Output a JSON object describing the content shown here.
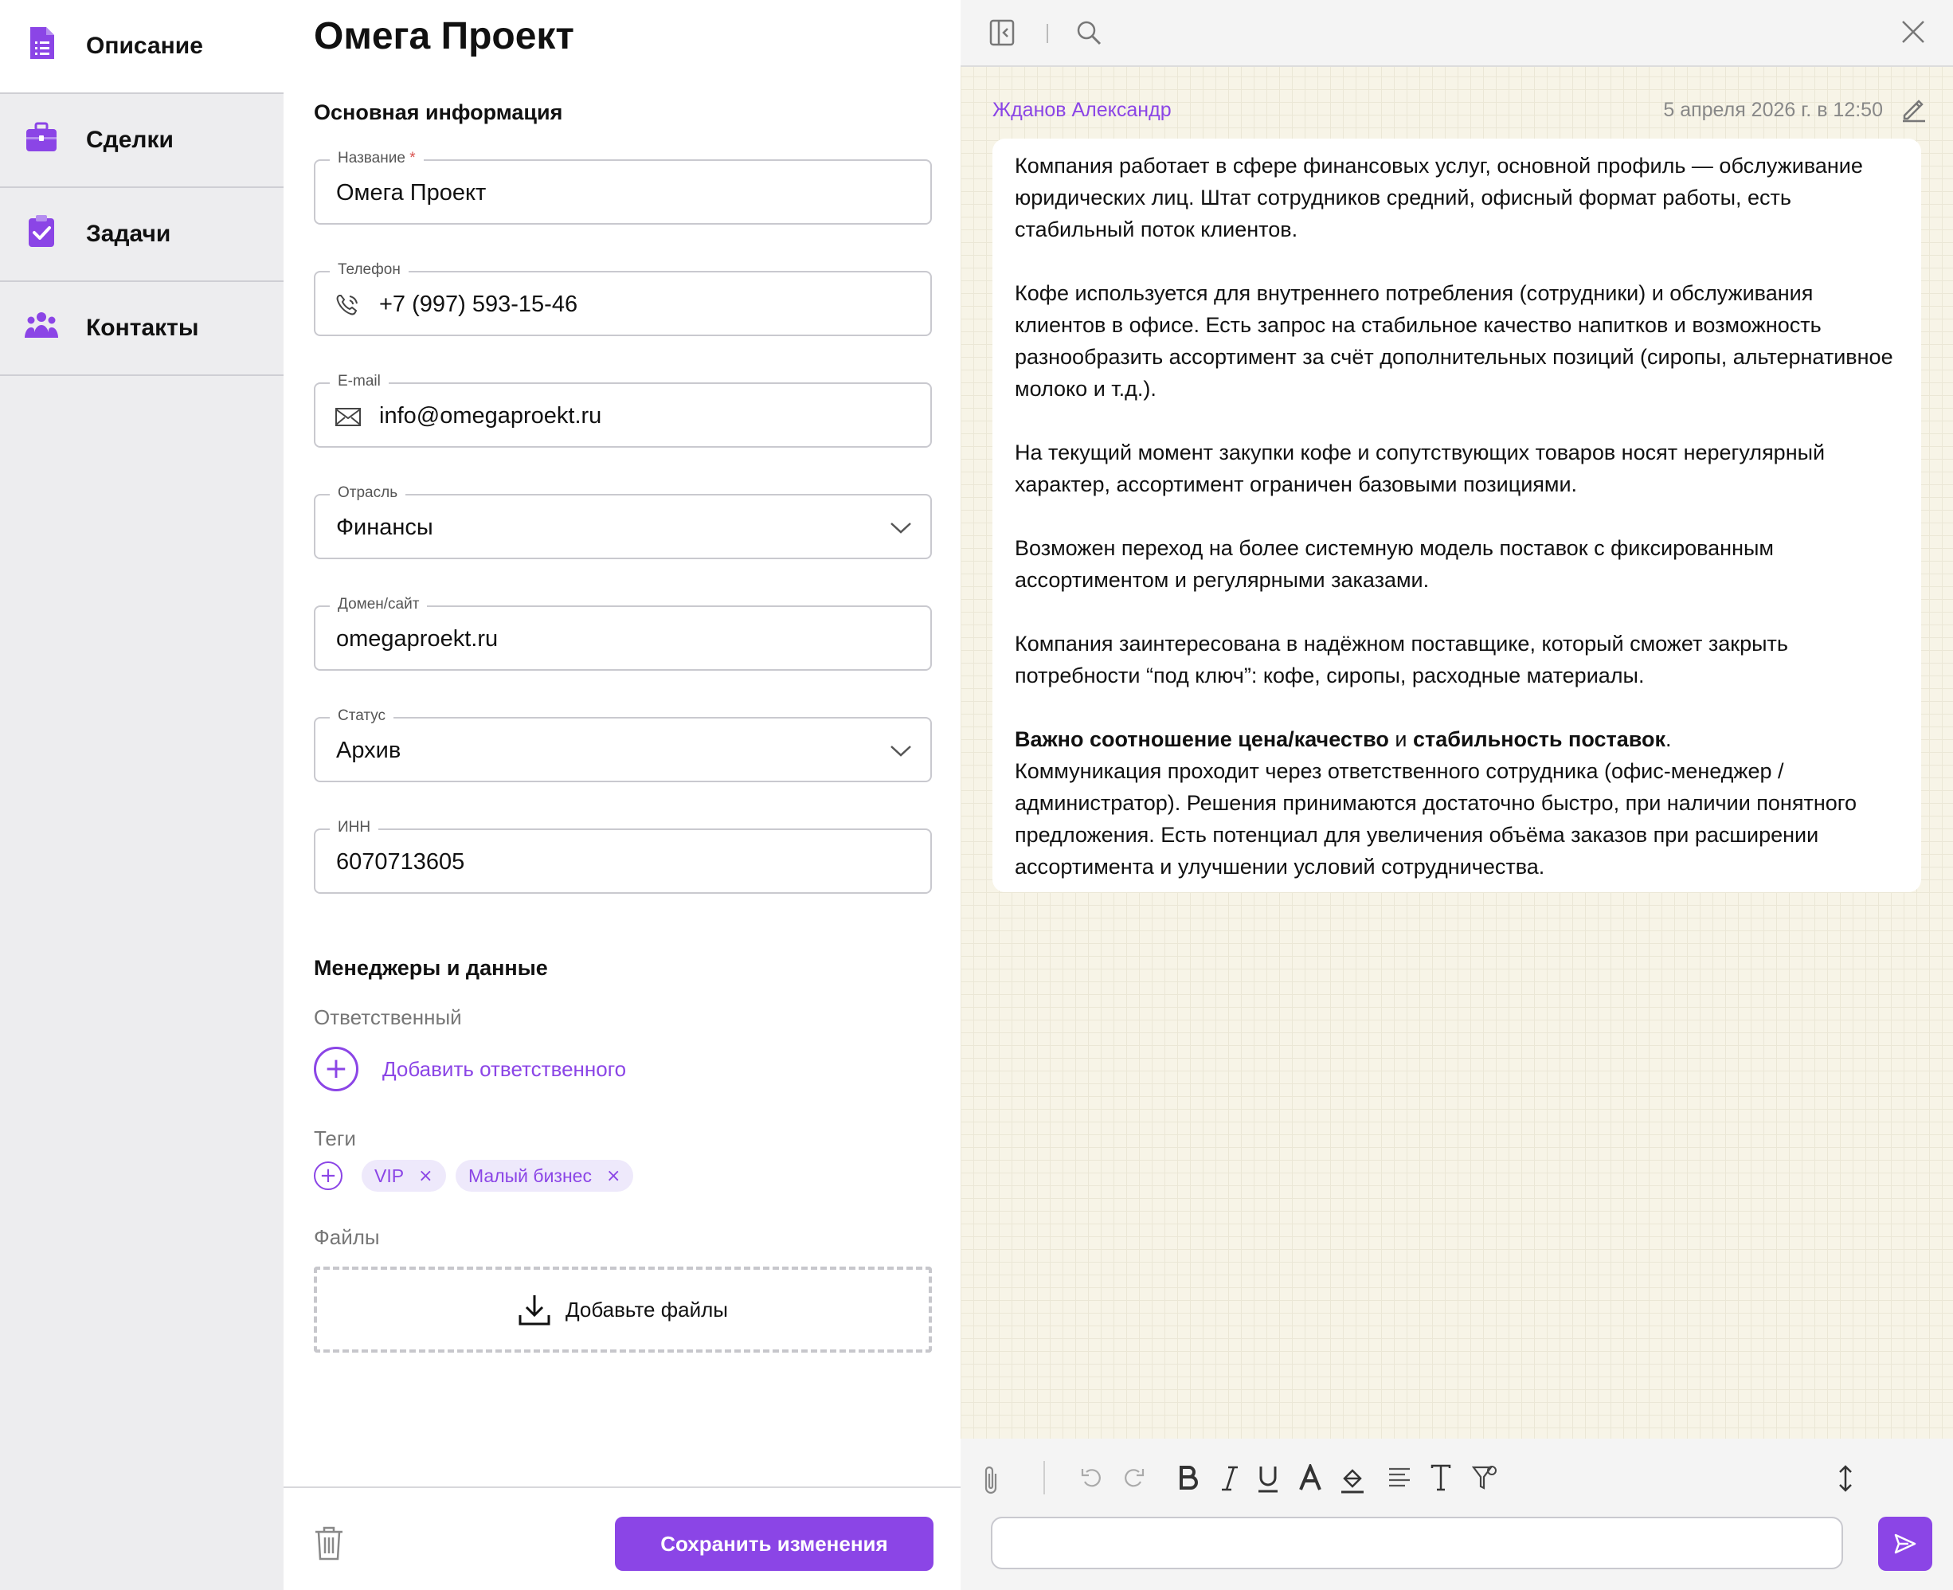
{
  "sidebar": {
    "items": [
      {
        "label": "Описание",
        "icon": "document-list-icon",
        "active": true
      },
      {
        "label": "Сделки",
        "icon": "briefcase-icon",
        "active": false
      },
      {
        "label": "Задачи",
        "icon": "clipboard-check-icon",
        "active": false
      },
      {
        "label": "Контакты",
        "icon": "people-icon",
        "active": false
      }
    ]
  },
  "main": {
    "title": "Омега Проект",
    "basic_section": "Основная информация",
    "fields": {
      "name": {
        "label": "Название",
        "required_mark": "*",
        "value": "Омега Проект"
      },
      "phone": {
        "label": "Телефон",
        "value": "+7 (997) 593-15-46"
      },
      "email": {
        "label": "E-mail",
        "value": "info@omegaproekt.ru"
      },
      "industry": {
        "label": "Отрасль",
        "value": "Финансы"
      },
      "domain": {
        "label": "Домен/сайт",
        "value": "omegaproekt.ru"
      },
      "status": {
        "label": "Статус",
        "value": "Архив"
      },
      "inn": {
        "label": "ИНН",
        "value": "6070713605"
      }
    },
    "managers_section": "Менеджеры и данные",
    "responsible_label": "Ответственный",
    "add_responsible": "Добавить ответственного",
    "tags_label": "Теги",
    "tags": [
      "VIP",
      "Малый бизнес"
    ],
    "files_label": "Файлы",
    "add_files": "Добавьте файлы",
    "save_button": "Сохранить изменения"
  },
  "note": {
    "author": "Жданов Александр",
    "timestamp": "5 апреля 2026 г. в 12:50",
    "paragraphs": [
      "Компания работает в сфере финансовых услуг, основной профиль — обслуживание юридических лиц. Штат сотрудников средний, офисный формат работы, есть стабильный поток клиентов.",
      "Кофе используется для внутреннего потребления (сотрудники) и обслуживания клиентов в офисе. Есть запрос на стабильное качество напитков и возможность разнообразить ассортимент за счёт дополнительных позиций (сиропы, альтернативное молоко и т.д.).",
      "На текущий момент закупки кофе и сопутствующих товаров носят нерегулярный характер, ассортимент ограничен базовыми позициями.",
      "Возможен переход на более системную модель поставок с фиксированным ассортиментом и регулярными заказами.",
      "Компания заинтересована в надёжном поставщике, который сможет закрыть потребности “под ключ”: кофе, сиропы, расходные материалы."
    ],
    "bold_1": "Важно соотношение цена/качество",
    "connector": " и ",
    "bold_2": "стабильность поставок",
    "period": ".",
    "last_paragraph": "Коммуникация проходит через ответственного сотрудника (офис-менеджер / администратор). Решения принимаются достаточно быстро, при наличии понятного предложения. Есть потенциал для увеличения объёма заказов при расширении ассортимента и улучшении условий сотрудничества."
  },
  "comment": {
    "placeholder": ""
  },
  "colors": {
    "accent": "#8b45e6",
    "sidebar_bg": "#ededef",
    "note_bg": "#f7f4e7"
  }
}
